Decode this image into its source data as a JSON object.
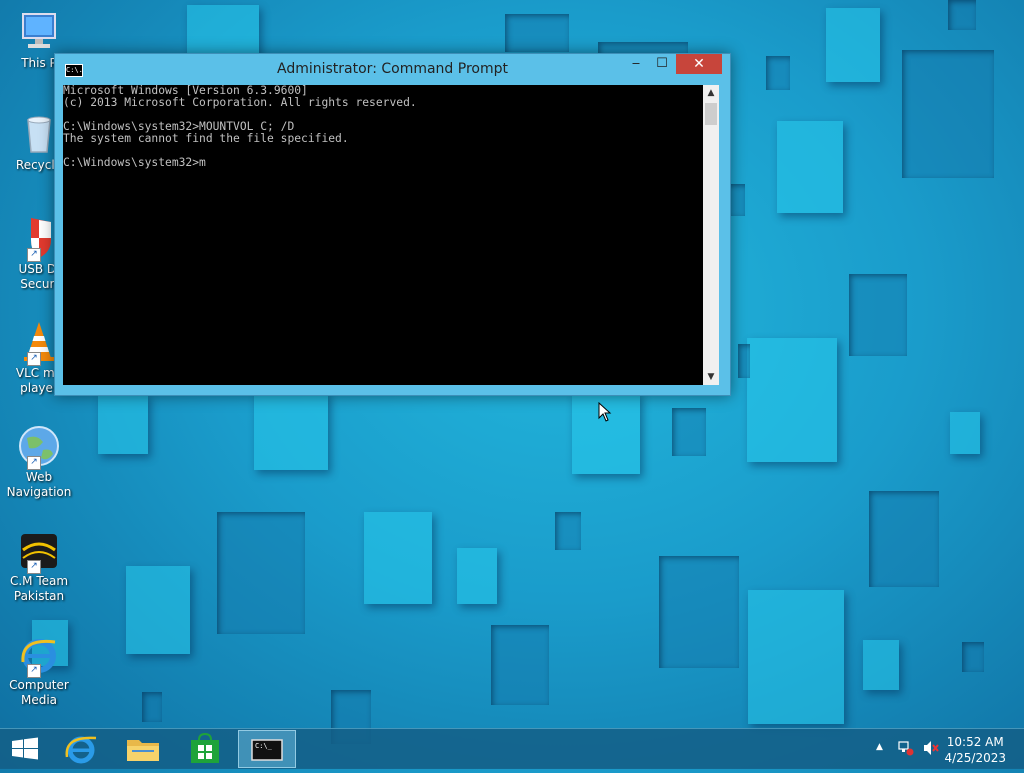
{
  "desktop": {
    "icons": [
      {
        "label": "This P",
        "icon": "computer-icon"
      },
      {
        "label": "Recycle",
        "icon": "recycle-bin-icon"
      },
      {
        "label": "USB Di\nSecuri",
        "icon": "usb-security-shield-icon"
      },
      {
        "label": "VLC me\nplayer",
        "icon": "vlc-cone-icon"
      },
      {
        "label": "Web\nNavigation",
        "icon": "globe-icon"
      },
      {
        "label": "C.M Team\nPakistan",
        "icon": "cm-team-logo-icon"
      },
      {
        "label": "Computer\nMedia",
        "icon": "internet-explorer-icon"
      }
    ]
  },
  "window": {
    "title": "Administrator: Command Prompt",
    "icon_text": "C:\\.",
    "minimize": "‒",
    "maximize": "☐",
    "close": "✕",
    "console_lines": [
      "Microsoft Windows [Version 6.3.9600]",
      "(c) 2013 Microsoft Corporation. All rights reserved.",
      "",
      "C:\\Windows\\system32>MOUNTVOL C; /D",
      "The system cannot find the file specified.",
      "",
      "C:\\Windows\\system32>m"
    ]
  },
  "taskbar": {
    "buttons": [
      {
        "name": "start",
        "icon": "windows-logo-icon"
      },
      {
        "name": "internet-explorer",
        "icon": "internet-explorer-icon"
      },
      {
        "name": "file-explorer",
        "icon": "folder-icon"
      },
      {
        "name": "store",
        "icon": "store-bag-icon"
      },
      {
        "name": "command-prompt",
        "icon": "command-prompt-icon",
        "active": true
      }
    ],
    "tray": {
      "overflow": "▲",
      "time": "10:52 AM",
      "date": "4/25/2023"
    }
  },
  "colors": {
    "window_frame": "#5bc0e8",
    "close_button": "#c7453b",
    "console_bg": "#000000",
    "console_text": "#c0c0c0"
  }
}
